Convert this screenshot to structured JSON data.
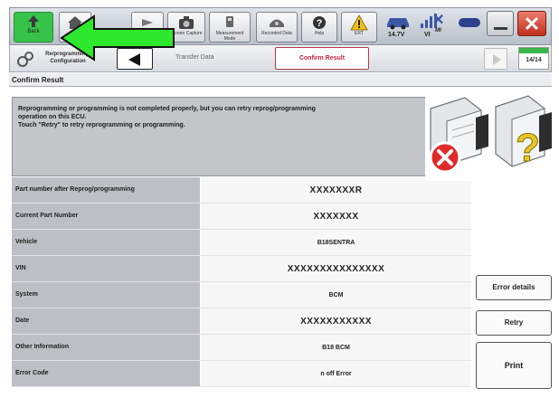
{
  "toolbar": {
    "back_label": "Back",
    "screen_capture_label": "Screen Capture",
    "measurement_mode_label": "Measurement Mode",
    "recorded_data_label": "Recorded Data",
    "help_label": "Help",
    "ert_label": "ERT",
    "voltage": "14.7V",
    "vi_label": "VI",
    "mi_label": "MI"
  },
  "stepbar": {
    "category": "Re/programming, Configuration",
    "transfer_step": "Transfer Data",
    "confirm_step": "Confirm Result",
    "page_counter": "14/14"
  },
  "section_title": "Confirm Result",
  "message": "Reprogramming or programming is not completed properly, but you can retry reprog/programming\noperation on this ECU.\nTouch \"Retry\" to retry reprogramming or programming.",
  "rows": [
    {
      "label": "Part number after Reprog/programming",
      "value": "XXXXXXXR"
    },
    {
      "label": "Current Part Number",
      "value": "XXXXXXX"
    },
    {
      "label": "Vehicle",
      "value": "B18SENTRA"
    },
    {
      "label": "VIN",
      "value": "XXXXXXXXXXXXXXX"
    },
    {
      "label": "System",
      "value": "BCM"
    },
    {
      "label": "Date",
      "value": "XXXXXXXXXXX"
    },
    {
      "label": "Other Information",
      "value": "B18 BCM"
    },
    {
      "label": "Error Code",
      "value": "n off Error"
    }
  ],
  "buttons": {
    "error_details": "Error details",
    "retry": "Retry",
    "print": "Print"
  },
  "colors": {
    "back_button": "#37c34a",
    "arrow": "#2ee82e",
    "confirm_step_border": "#b03b4a",
    "close_button": "#c2301f"
  }
}
